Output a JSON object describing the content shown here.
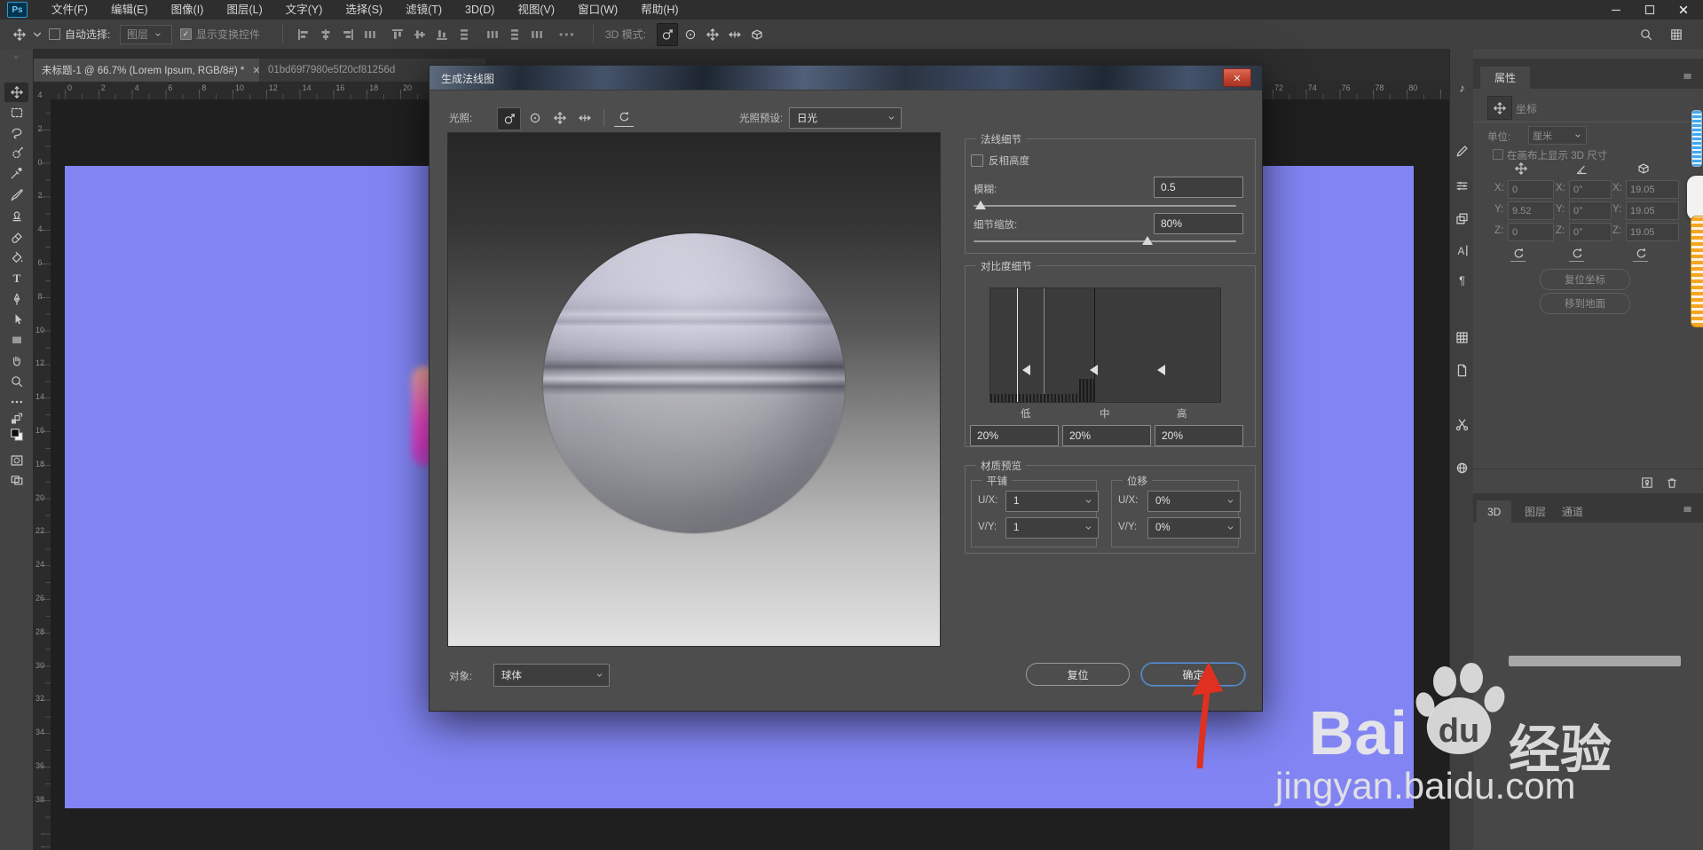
{
  "window": {
    "minimize": "—",
    "maximize": "▢",
    "close": "✕"
  },
  "menu": {
    "items": [
      "文件(F)",
      "编辑(E)",
      "图像(I)",
      "图层(L)",
      "文字(Y)",
      "选择(S)",
      "滤镜(T)",
      "3D(D)",
      "视图(V)",
      "窗口(W)",
      "帮助(H)"
    ],
    "logo": "Ps"
  },
  "options_bar": {
    "auto_select_label": "自动选择:",
    "layer_dropdown_value": "图层",
    "show_transform_label": "显示变换控件",
    "more_glyph": "•••",
    "mode_label": "3D 模式:",
    "check_glyph": "✓"
  },
  "tabs": {
    "tab1": "未标题-1 @ 66.7% (Lorem Ipsum, RGB/8#) *",
    "tab2": "01bd69f7980e5f20cf81256d",
    "close_glyph": "✕"
  },
  "toolbar": {
    "grip": "≡",
    "tools": [
      "move-tool-icon",
      "marquee-tool-icon",
      "lasso-tool-icon",
      "quick-selection-tool-icon",
      "eyedropper-tool-icon",
      "brush-tool-icon",
      "clone-stamp-tool-icon",
      "eraser-tool-icon",
      "paint-bucket-tool-icon",
      "type-tool-icon",
      "pen-tool-icon",
      "path-select-tool-icon",
      "rectangle-tool-icon",
      "hand-tool-icon",
      "zoom-tool-icon",
      "more-tools-icon",
      "swap-colors-icon",
      "foreground-background-swatch",
      "quick-mask-icon",
      "screen-mode-icon"
    ]
  },
  "rulers": {
    "h_left": [
      "0",
      "2",
      "4",
      "6",
      "8",
      "10",
      "12",
      "14",
      "16",
      "18",
      "20"
    ],
    "h_right": [
      "72",
      "74",
      "76",
      "78",
      "80"
    ],
    "v": [
      "4",
      "2",
      "0",
      "2",
      "4",
      "6",
      "8",
      "10",
      "12",
      "14",
      "16",
      "18",
      "20",
      "22",
      "24",
      "26",
      "28",
      "30",
      "32",
      "34",
      "36",
      "38"
    ]
  },
  "dialog": {
    "title": "生成法线图",
    "light_label": "光照:",
    "preset_label": "光照预设:",
    "preset_value": "日光",
    "normal_detail": {
      "title": "法线细节",
      "invert_label": "反相高度",
      "blur_label": "模糊:",
      "blur_value": "0.5",
      "scale_label": "细节缩放:",
      "scale_value": "80%"
    },
    "contrast_detail": {
      "title": "对比度细节",
      "low_label": "低",
      "mid_label": "中",
      "high_label": "高",
      "low_value": "20%",
      "mid_value": "20%",
      "high_value": "20%"
    },
    "material_preview": {
      "title": "材质预览",
      "tile_title": "平铺",
      "offset_title": "位移",
      "ux_label": "U/X:",
      "vy_label": "V/Y:",
      "tile_ux": "1",
      "tile_vy": "1",
      "offset_ux": "0%",
      "offset_vy": "0%"
    },
    "object_label": "对象:",
    "object_value": "球体",
    "reset_button": "复位",
    "ok_button": "确定"
  },
  "properties": {
    "panel_title": "属性",
    "coords_label": "坐标",
    "unit_label": "单位:",
    "unit_value": "厘米",
    "show_3d_label": "在画布上显示 3D 尺寸",
    "axis_labels": [
      "X:",
      "Y:",
      "Z:"
    ],
    "pos": {
      "x": "0",
      "y": "9.52",
      "z": "0"
    },
    "rot": {
      "x": "0°",
      "y": "0°",
      "z": "0°"
    },
    "scale": {
      "x": "19.05",
      "y": "19.05",
      "z": "19.05"
    },
    "reset_coords_button": "复位坐标",
    "to_ground_button": "移到地面",
    "tab_3d": "3D",
    "tab_layers": "图层",
    "tab_channels": "通道"
  },
  "dock_icons": [
    "music-note-icon",
    "pencil-icon",
    "sliders-icon",
    "layers-icon",
    "character-panel-icon",
    "paragraph-panel-icon",
    "grid-panel-icon",
    "document-panel-icon",
    "scissors-icon",
    "sphere-panel-icon"
  ],
  "watermark": {
    "bai": "Bai",
    "du": "du",
    "jingyan": "经验",
    "url": "jingyan.baidu.com"
  },
  "icons": {
    "reset_glyph": "↺",
    "chevron_glyph": "∨",
    "music_glyph": "♪",
    "paragraph_glyph": "¶",
    "char_glyph": "A"
  },
  "colors": {
    "canvas": "#8184f2",
    "accent_blue": "#5590d9",
    "close_red": "#c14431",
    "arrow_red": "#e03020"
  }
}
